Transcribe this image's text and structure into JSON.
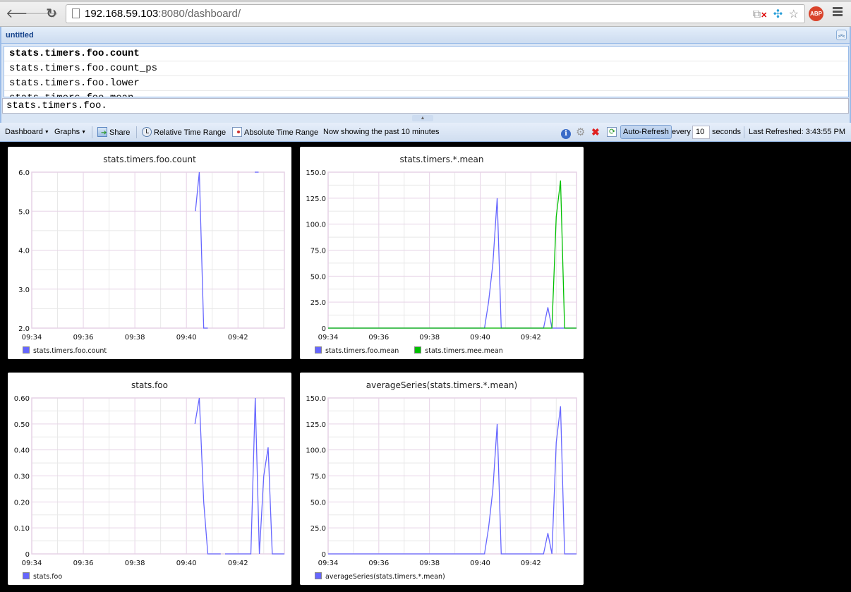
{
  "browser": {
    "url_host": "192.168.59.103",
    "url_rest": ":8080/dashboard/",
    "back_icon": "arrow-left-icon",
    "forward_icon": "arrow-right-icon",
    "reload_icon": "reload-icon",
    "abp_label": "ABP"
  },
  "panel": {
    "title": "untitled",
    "completions": [
      "stats.timers.foo.count",
      "stats.timers.foo.count_ps",
      "stats.timers.foo.lower",
      "stats.timers.foo.mean"
    ],
    "selected_index": 0,
    "input_value": "stats.timers.foo."
  },
  "toolbar": {
    "dashboard_label": "Dashboard",
    "graphs_label": "Graphs",
    "share_label": "Share",
    "relative_label": "Relative Time Range",
    "absolute_label": "Absolute Time Range",
    "status_text": "Now showing the past 10 minutes",
    "autorefresh_label": "Auto-Refresh",
    "every_label": "every",
    "interval_value": "10",
    "seconds_label": "seconds",
    "last_refreshed_label": "Last Refreshed:",
    "last_refreshed_time": "3:43:55 PM"
  },
  "colors": {
    "blue_series": "#6666ff",
    "green_series": "#00c000",
    "grid_major": "#e6d2e6",
    "grid_minor": "#e8e8e8"
  },
  "chart_data": [
    {
      "type": "line",
      "title": "stats.timers.foo.count",
      "x_ticks": [
        "09:34",
        "09:36",
        "09:38",
        "09:40",
        "09:42"
      ],
      "x_range_minutes": [
        0,
        9.8
      ],
      "y_ticks": [
        "2.0",
        "3.0",
        "4.0",
        "5.0",
        "6.0"
      ],
      "ylim": [
        2,
        6
      ],
      "series": [
        {
          "name": "stats.timers.foo.count",
          "color": "#6666ff",
          "points": [
            [
              6.35,
              5
            ],
            [
              6.5,
              6
            ],
            [
              6.67,
              2
            ],
            [
              6.83,
              2
            ],
            null,
            [
              8.65,
              6
            ],
            [
              8.8,
              6
            ]
          ]
        }
      ]
    },
    {
      "type": "line",
      "title": "stats.timers.*.mean",
      "x_ticks": [
        "09:34",
        "09:36",
        "09:38",
        "09:40",
        "09:42"
      ],
      "x_range_minutes": [
        0,
        9.8
      ],
      "y_ticks": [
        "0",
        "25.0",
        "50.0",
        "75.0",
        "100.0",
        "125.0",
        "150.0"
      ],
      "ylim": [
        0,
        150
      ],
      "series": [
        {
          "name": "stats.timers.foo.mean",
          "color": "#6666ff",
          "points": [
            [
              0,
              0
            ],
            [
              6.17,
              0
            ],
            [
              6.33,
              25
            ],
            [
              6.5,
              62
            ],
            [
              6.67,
              125
            ],
            [
              6.83,
              0
            ],
            [
              8.5,
              0
            ],
            [
              8.67,
              20
            ],
            [
              8.83,
              0
            ],
            [
              9.8,
              0
            ]
          ]
        },
        {
          "name": "stats.timers.mee.mean",
          "color": "#00c000",
          "points": [
            [
              0,
              0
            ],
            [
              8.83,
              0
            ],
            [
              9.0,
              107
            ],
            [
              9.17,
              142
            ],
            [
              9.33,
              0
            ],
            [
              9.8,
              0
            ]
          ]
        }
      ]
    },
    {
      "type": "line",
      "title": "stats.foo",
      "x_ticks": [
        "09:34",
        "09:36",
        "09:38",
        "09:40",
        "09:42"
      ],
      "x_range_minutes": [
        0,
        9.8
      ],
      "y_ticks": [
        "0",
        "0.10",
        "0.20",
        "0.30",
        "0.40",
        "0.50",
        "0.60"
      ],
      "ylim": [
        0,
        0.6
      ],
      "series": [
        {
          "name": "stats.foo",
          "color": "#6666ff",
          "points": [
            [
              6.33,
              0.5
            ],
            [
              6.5,
              0.6
            ],
            [
              6.67,
              0.2
            ],
            [
              6.83,
              0
            ],
            [
              7.33,
              0
            ],
            null,
            [
              7.5,
              0
            ],
            [
              8.5,
              0
            ],
            [
              8.67,
              0.6
            ],
            [
              8.83,
              0
            ],
            [
              9.0,
              0.3
            ],
            [
              9.17,
              0.41
            ],
            [
              9.33,
              0
            ],
            [
              9.8,
              0
            ]
          ]
        }
      ]
    },
    {
      "type": "line",
      "title": "averageSeries(stats.timers.*.mean)",
      "x_ticks": [
        "09:34",
        "09:36",
        "09:38",
        "09:40",
        "09:42"
      ],
      "x_range_minutes": [
        0,
        9.8
      ],
      "y_ticks": [
        "0",
        "25.0",
        "50.0",
        "75.0",
        "100.0",
        "125.0",
        "150.0"
      ],
      "ylim": [
        0,
        150
      ],
      "series": [
        {
          "name": "averageSeries(stats.timers.*.mean)",
          "color": "#6666ff",
          "points": [
            [
              0,
              0
            ],
            [
              6.17,
              0
            ],
            [
              6.33,
              25
            ],
            [
              6.5,
              62
            ],
            [
              6.67,
              125
            ],
            [
              6.83,
              0
            ],
            [
              8.5,
              0
            ],
            [
              8.67,
              20
            ],
            [
              8.83,
              0
            ],
            [
              9.0,
              107
            ],
            [
              9.17,
              142
            ],
            [
              9.33,
              0
            ],
            [
              9.8,
              0
            ]
          ]
        }
      ]
    }
  ]
}
